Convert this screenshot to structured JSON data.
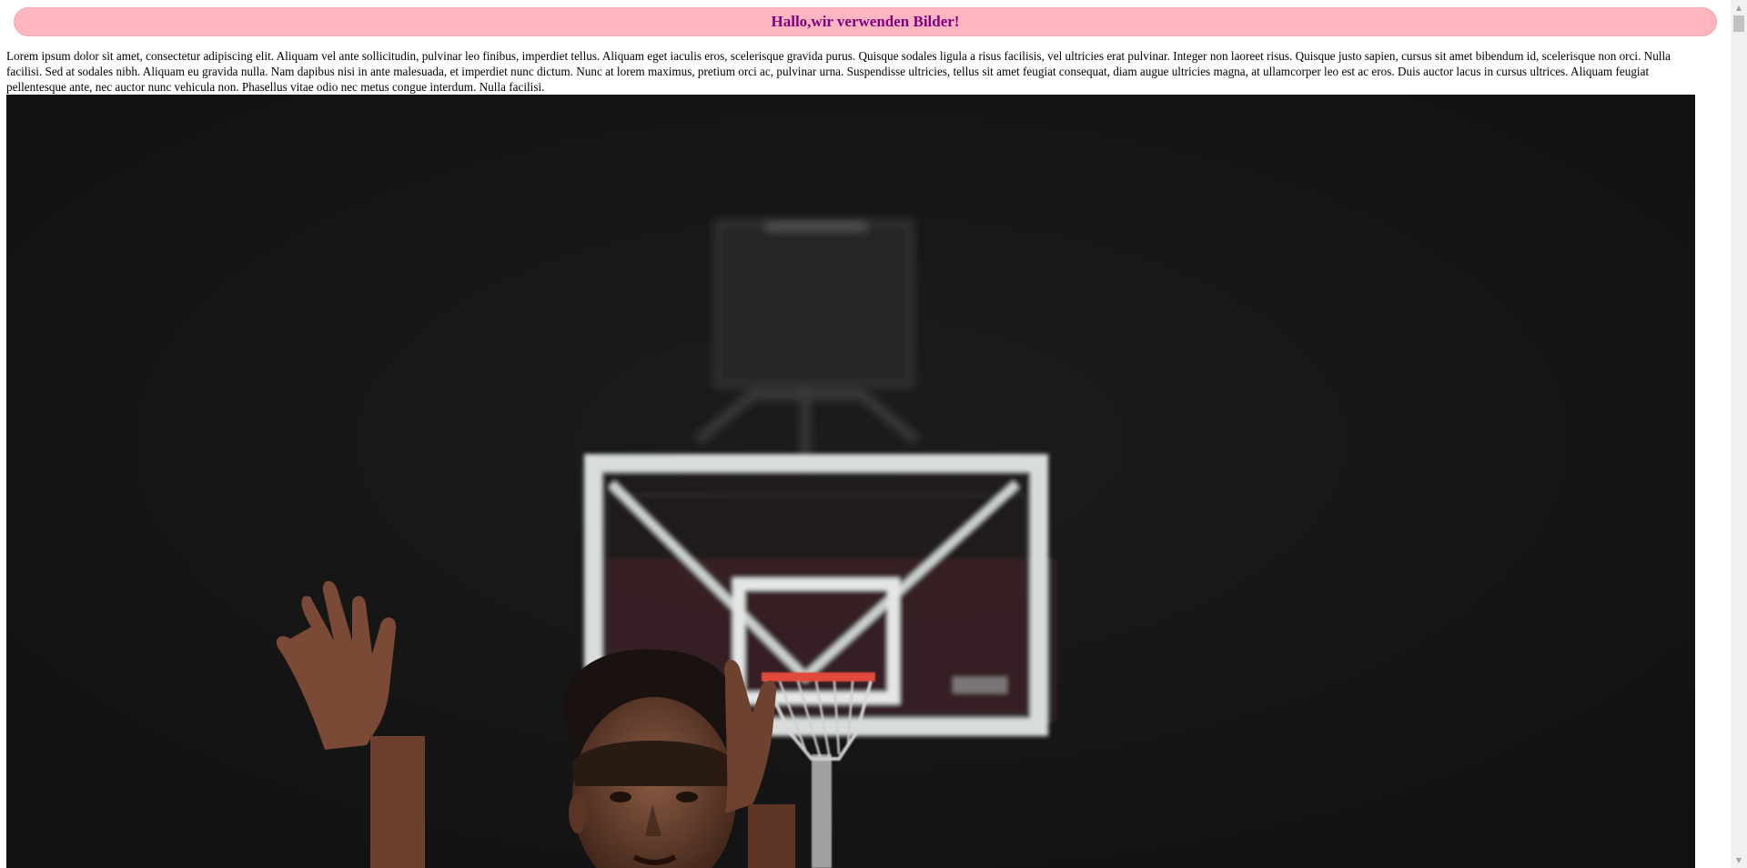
{
  "header": {
    "title": "Hallo,wir verwenden Bilder!"
  },
  "content": {
    "paragraph": "Lorem ipsum dolor sit amet, consectetur adipiscing elit. Aliquam vel ante sollicitudin, pulvinar leo finibus, imperdiet tellus. Aliquam eget iaculis eros, scelerisque gravida purus. Quisque sodales ligula a risus facilisis, vel ultricies erat pulvinar. Integer non laoreet risus. Quisque justo sapien, cursus sit amet bibendum id, scelerisque non orci. Nulla facilisi. Sed at sodales nibh. Aliquam eu gravida nulla. Nam dapibus nisi in ante malesuada, et imperdiet nunc dictum. Nunc at lorem maximus, pretium orci ac, pulvinar urna. Suspendisse ultricies, tellus sit amet feugiat consequat, diam augue ultricies magna, at ullamcorper leo est ac eros. Duis auctor lacus in cursus ultrices. Aliquam feugiat pellentesque ante, nec auctor nunc vehicula non. Phasellus vitae odio nec metus congue interdum. Nulla facilisi."
  },
  "photo": {
    "subject": "basketball-player-under-hoop"
  },
  "colors": {
    "banner_background": "#ffb6c1",
    "banner_text": "#800080",
    "photo_background": "#141414"
  },
  "icons": {
    "scroll_up": "scroll-up-arrow-icon",
    "scroll_down": "scroll-down-arrow-icon"
  }
}
